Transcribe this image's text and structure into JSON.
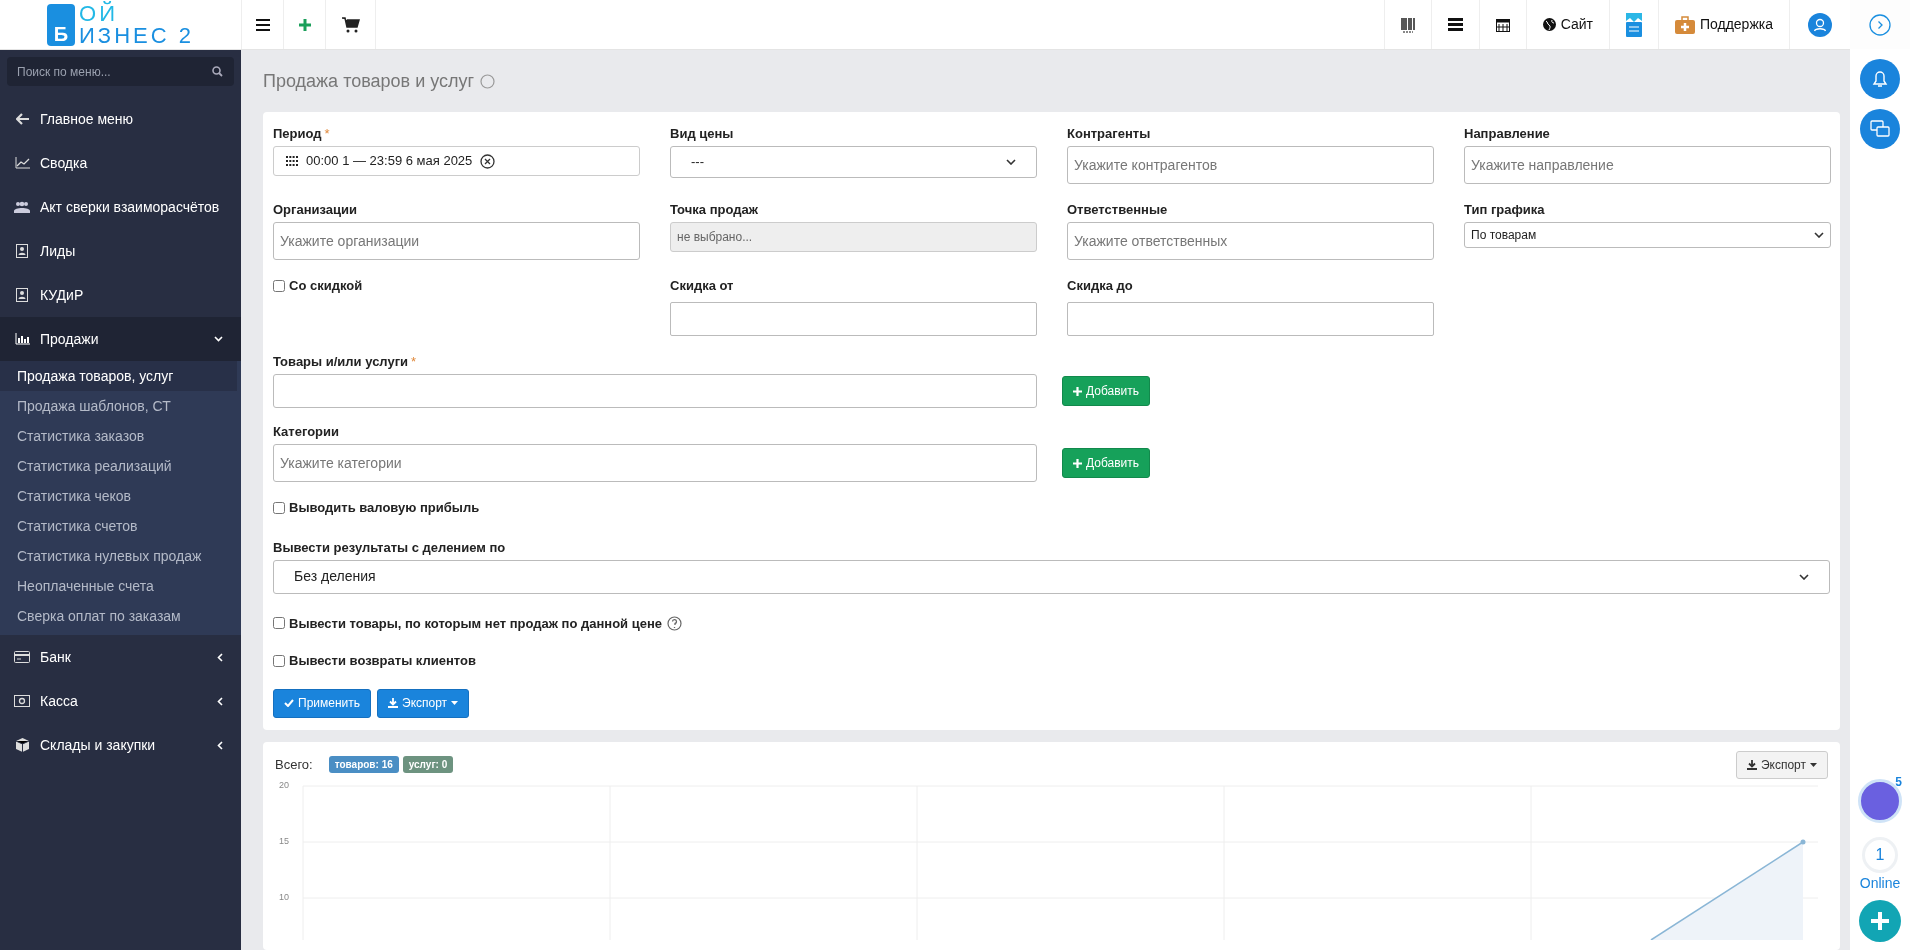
{
  "logo": {
    "mark_letter": "Б",
    "line_1": "ОЙ",
    "line_2": "ИЗНЕС 2"
  },
  "header": {
    "right_links": [
      {
        "kind": "barcode"
      },
      {
        "kind": "list"
      },
      {
        "kind": "calendar"
      },
      {
        "kind": "globe",
        "label": "Сайт"
      },
      {
        "kind": "app"
      },
      {
        "kind": "support",
        "label": "Поддержка"
      }
    ]
  },
  "sidebar": {
    "search": {
      "placeholder": "Поиск по меню..."
    },
    "items": [
      {
        "label": "Главное меню"
      },
      {
        "label": "Сводка"
      },
      {
        "label": "Акт сверки взаиморасчётов"
      },
      {
        "label": "Лиды"
      },
      {
        "label": "КУДиР"
      },
      {
        "label": "Продажи",
        "expanded": true,
        "children": [
          {
            "label": "Продажа товаров, услуг",
            "selected": true
          },
          {
            "label": "Продажа шаблонов, СТ",
            "selected": false
          },
          {
            "label": "Статистика заказов",
            "selected": false
          },
          {
            "label": "Статистика реализаций",
            "selected": false
          },
          {
            "label": "Статистика чеков",
            "selected": false
          },
          {
            "label": "Статистика счетов",
            "selected": false
          },
          {
            "label": "Статистика нулевых продаж",
            "selected": false
          },
          {
            "label": "Неоплаченные счета",
            "selected": false
          },
          {
            "label": "Сверка оплат по заказам",
            "selected": false
          }
        ]
      },
      {
        "label": "Банк",
        "expanded": false
      },
      {
        "label": "Касса",
        "expanded": false
      },
      {
        "label": "Склады и закупки",
        "expanded": false
      }
    ]
  },
  "page_title": "Продажа товаров и услуг",
  "filters": {
    "grid": [
      {
        "kind": "daterange",
        "label": "Период",
        "required_mark": "*",
        "value": "00:00 1 — 23:59 6 мая 2025"
      },
      {
        "kind": "select",
        "label": "Вид цены",
        "value": "---"
      },
      {
        "kind": "tags",
        "label": "Контрагенты",
        "placeholder": "Укажите контрагентов"
      },
      {
        "kind": "tags",
        "label": "Направление",
        "placeholder": "Укажите направление"
      },
      {
        "kind": "tags",
        "label": "Организации",
        "placeholder": "Укажите организации"
      },
      {
        "kind": "disabled",
        "label": "Точка продаж",
        "value": "не выбрано..."
      },
      {
        "kind": "tags",
        "label": "Ответственные",
        "placeholder": "Укажите ответственных"
      },
      {
        "kind": "smallselect",
        "label": "Тип графика",
        "value": "По товарам"
      },
      {
        "kind": "checkbox",
        "label": "Со скидкой",
        "checked": false
      },
      {
        "kind": "text",
        "label": "Скидка от"
      },
      {
        "kind": "text",
        "label": "Скидка до"
      }
    ],
    "products": {
      "label": "Товары и/или услуги",
      "required_mark": "*",
      "button": "Добавить"
    },
    "categories": {
      "label": "Категории",
      "placeholder": "Укажите категории",
      "button": "Добавить"
    },
    "gross_profit": {
      "label": "Выводить валовую прибыль",
      "checked": false
    },
    "split": {
      "label": "Вывести результаты с делением по",
      "value": "Без деления"
    },
    "options": [
      {
        "label": "Вывести товары, по которым нет продаж по данной цене",
        "checked": false,
        "help": true
      },
      {
        "label": "Вывести возвраты клиентов",
        "checked": false,
        "help": false
      }
    ],
    "actions": [
      {
        "label": "Применить",
        "kind": "apply"
      },
      {
        "label": "Экспорт",
        "kind": "export"
      }
    ]
  },
  "results": {
    "total_label": "Всего:",
    "badges": [
      {
        "label": "товаров: 16",
        "color": "#4a8ec4"
      },
      {
        "label": "услуг: 0",
        "color": "#6d9380"
      }
    ],
    "export_button": "Экспорт",
    "y_axis_labels": [
      "20",
      "15",
      "10"
    ]
  },
  "right_rail": {
    "avatar_badge": "5",
    "online_count": "1",
    "online_label": "Online"
  }
}
